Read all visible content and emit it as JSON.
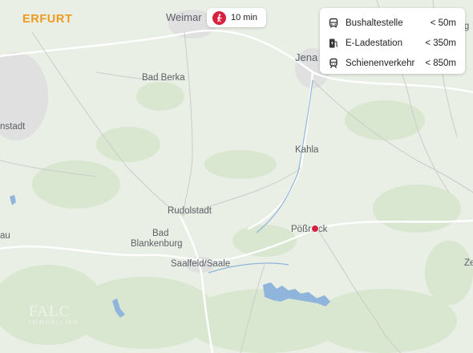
{
  "city_label": "ERFURT",
  "walk_time": {
    "label": "10 min",
    "icon": "pedestrian-icon"
  },
  "legend": [
    {
      "icon": "bus-icon",
      "label": "Bushaltestelle",
      "distance": "< 50m"
    },
    {
      "icon": "ev-charging-icon",
      "label": "E-Ladestation",
      "distance": "< 350m"
    },
    {
      "icon": "train-icon",
      "label": "Schienenverkehr",
      "distance": "< 850m"
    }
  ],
  "places": {
    "weimar": "Weimar",
    "jena": "Jena",
    "bad_berka": "Bad Berka",
    "stadt": "nstadt",
    "kahla": "Kahla",
    "rudolstadt": "Rudolstadt",
    "bad": "Bad",
    "blankenburg": "Blankenburg",
    "saalfeld": "Saalfeld/Saale",
    "possneck": "Pößneck",
    "au": "au",
    "rg": "rg",
    "ze": "Ze"
  },
  "logo": {
    "main": "FALC",
    "sub": "IMMOBILIEN"
  },
  "colors": {
    "accent": "#d6213f",
    "city": "#ee9a1e",
    "water": "#8fb5dd"
  }
}
